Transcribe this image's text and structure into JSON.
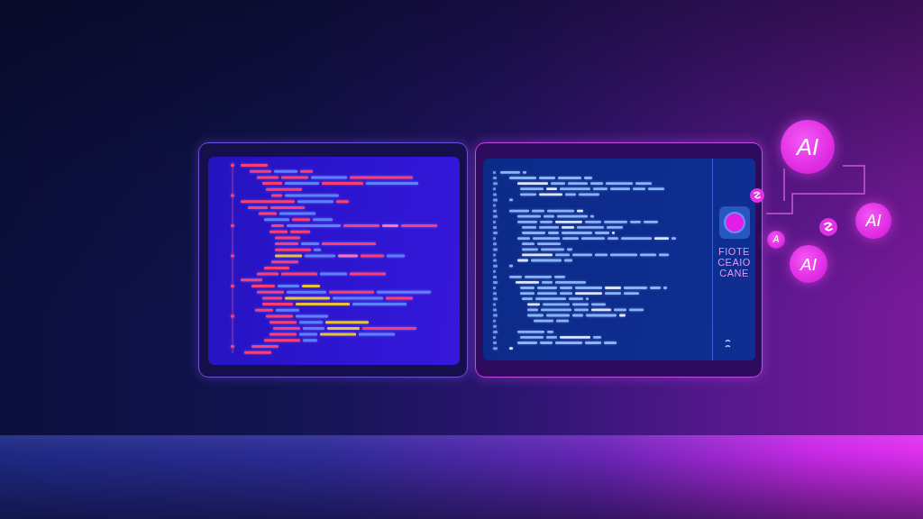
{
  "sidebar": {
    "labels": [
      "FIOTE",
      "CEAIO",
      "CANE"
    ]
  },
  "bubbles": [
    {
      "label": "AI"
    },
    {
      "label": "AI"
    },
    {
      "label": "A"
    },
    {
      "label": "AI"
    }
  ]
}
